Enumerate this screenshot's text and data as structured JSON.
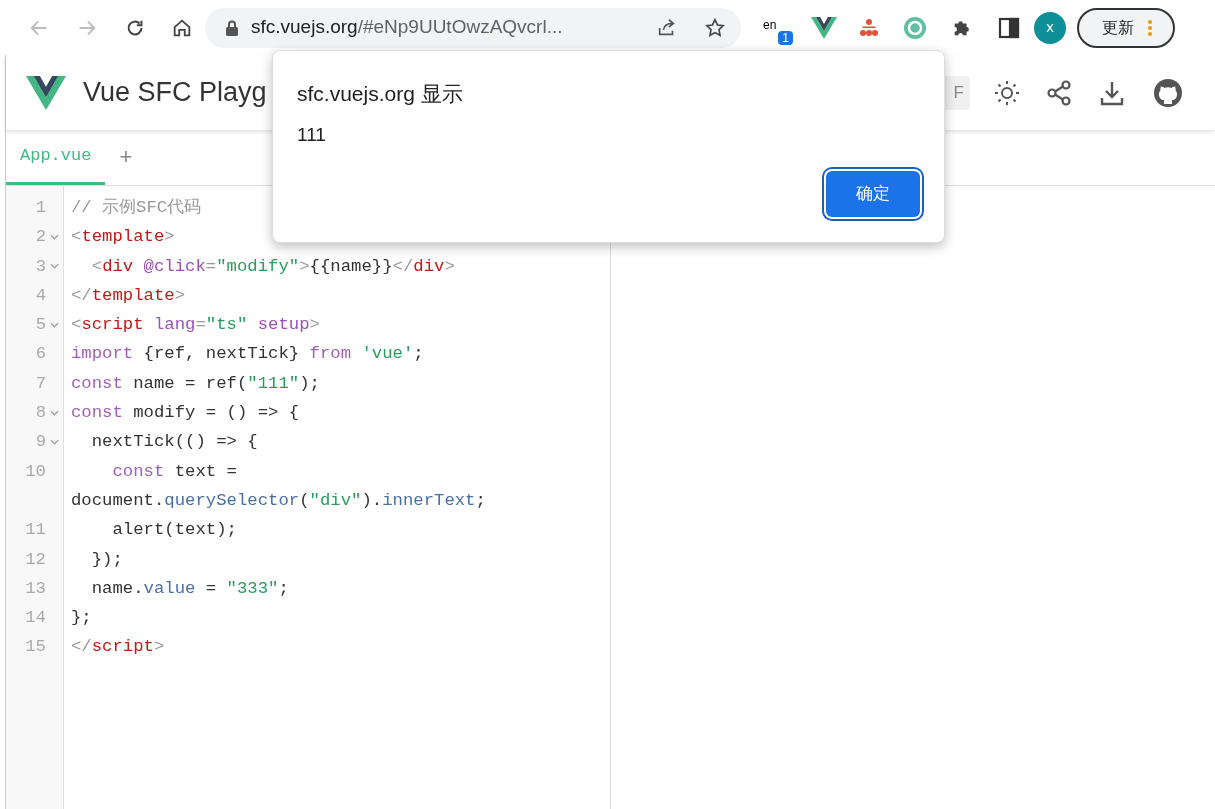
{
  "browser": {
    "url_host": "sfc.vuejs.org",
    "url_path": "/#eNp9UUtOwzAQvcrl...",
    "extension_badge": "1",
    "extension_label": "en",
    "profile_initial": "x",
    "update_button": "更新"
  },
  "header": {
    "title": "Vue SFC Playg",
    "version_chip": "F"
  },
  "tabs": [
    {
      "label": "App.vue",
      "selected": true
    },
    {
      "label": "+",
      "selected": false
    }
  ],
  "code_lines": [
    {
      "number": "1",
      "foldable": false,
      "tokens": [
        {
          "kind": "comment",
          "text": "// 示例SFC代码"
        }
      ]
    },
    {
      "number": "2",
      "foldable": true,
      "tokens": [
        {
          "kind": "punct",
          "text": "<"
        },
        {
          "kind": "tag",
          "text": "template"
        },
        {
          "kind": "punct",
          "text": ">"
        }
      ]
    },
    {
      "number": "3",
      "foldable": true,
      "tokens": [
        {
          "kind": "punct",
          "text": "  <"
        },
        {
          "kind": "tag",
          "text": "div"
        },
        {
          "kind": "attr",
          "text": " @click"
        },
        {
          "kind": "punct",
          "text": "="
        },
        {
          "kind": "string",
          "text": "\"modify\""
        },
        {
          "kind": "punct",
          "text": ">"
        },
        {
          "kind": "plain",
          "text": "{{name}}"
        },
        {
          "kind": "punct",
          "text": "</"
        },
        {
          "kind": "tag",
          "text": "div"
        },
        {
          "kind": "punct",
          "text": ">"
        }
      ]
    },
    {
      "number": "4",
      "foldable": false,
      "tokens": [
        {
          "kind": "punct",
          "text": "</"
        },
        {
          "kind": "tag",
          "text": "template"
        },
        {
          "kind": "punct",
          "text": ">"
        }
      ]
    },
    {
      "number": "5",
      "foldable": true,
      "tokens": [
        {
          "kind": "punct",
          "text": "<"
        },
        {
          "kind": "tag",
          "text": "script"
        },
        {
          "kind": "attr",
          "text": " lang"
        },
        {
          "kind": "punct",
          "text": "="
        },
        {
          "kind": "string",
          "text": "\"ts\""
        },
        {
          "kind": "attr",
          "text": " setup"
        },
        {
          "kind": "punct",
          "text": ">"
        }
      ]
    },
    {
      "number": "6",
      "foldable": false,
      "tokens": [
        {
          "kind": "keyword",
          "text": "import"
        },
        {
          "kind": "plain",
          "text": " {ref, nextTick} "
        },
        {
          "kind": "keyword",
          "text": "from"
        },
        {
          "kind": "string",
          "text": " 'vue'"
        },
        {
          "kind": "plain",
          "text": ";"
        }
      ]
    },
    {
      "number": "7",
      "foldable": false,
      "tokens": [
        {
          "kind": "keyword",
          "text": "const"
        },
        {
          "kind": "plain",
          "text": " name = ref("
        },
        {
          "kind": "string",
          "text": "\"111\""
        },
        {
          "kind": "plain",
          "text": ");"
        }
      ]
    },
    {
      "number": "8",
      "foldable": true,
      "tokens": [
        {
          "kind": "keyword",
          "text": "const"
        },
        {
          "kind": "plain",
          "text": " modify = () => {"
        }
      ]
    },
    {
      "number": "9",
      "foldable": true,
      "tokens": [
        {
          "kind": "plain",
          "text": "  nextTick(() => {"
        }
      ]
    },
    {
      "number": "10",
      "foldable": false,
      "tokens": [
        {
          "kind": "keyword",
          "text": "    const"
        },
        {
          "kind": "plain",
          "text": " text ="
        }
      ],
      "continuation": [
        {
          "kind": "plain",
          "text": "document."
        },
        {
          "kind": "prop",
          "text": "querySelector"
        },
        {
          "kind": "plain",
          "text": "("
        },
        {
          "kind": "string",
          "text": "\"div\""
        },
        {
          "kind": "plain",
          "text": ")."
        },
        {
          "kind": "prop",
          "text": "innerText"
        },
        {
          "kind": "plain",
          "text": ";"
        }
      ]
    },
    {
      "number": "11",
      "foldable": false,
      "tokens": [
        {
          "kind": "plain",
          "text": "    alert(text);"
        }
      ]
    },
    {
      "number": "12",
      "foldable": false,
      "tokens": [
        {
          "kind": "plain",
          "text": "  });"
        }
      ]
    },
    {
      "number": "13",
      "foldable": false,
      "tokens": [
        {
          "kind": "plain",
          "text": "  name."
        },
        {
          "kind": "prop",
          "text": "value"
        },
        {
          "kind": "plain",
          "text": " = "
        },
        {
          "kind": "string",
          "text": "\"333\""
        },
        {
          "kind": "plain",
          "text": ";"
        }
      ]
    },
    {
      "number": "14",
      "foldable": false,
      "tokens": [
        {
          "kind": "plain",
          "text": "};"
        }
      ]
    },
    {
      "number": "15",
      "foldable": false,
      "tokens": [
        {
          "kind": "punct",
          "text": "</"
        },
        {
          "kind": "tag",
          "text": "script"
        },
        {
          "kind": "punct",
          "text": ">"
        }
      ]
    }
  ],
  "dialog": {
    "title": "sfc.vuejs.org 显示",
    "message": "111",
    "ok_button": "确定"
  }
}
